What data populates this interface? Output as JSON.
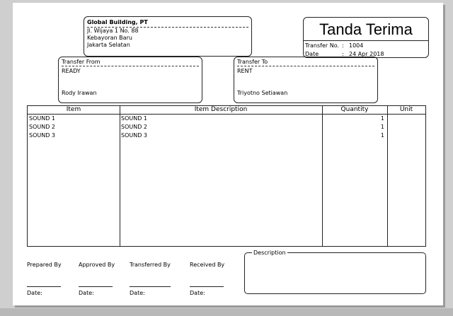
{
  "company": {
    "name": "Global Building, PT",
    "address": [
      "Jl. Wijaya 1 No. 88",
      "Kebayoran Baru",
      "Jakarta Selatan"
    ]
  },
  "doc": {
    "title": "Tanda Terima",
    "transfer_no_label": "Transfer No.",
    "transfer_no": "1004",
    "date_label": "Date",
    "date": "24 Apr 2018",
    "colon": ":"
  },
  "transfer_from": {
    "label": "Transfer From",
    "value": "READY",
    "person": "Rody Irawan"
  },
  "transfer_to": {
    "label": "Transfer To",
    "value": "RENT",
    "person": "Triyotno Setiawan"
  },
  "table": {
    "headers": {
      "item": "Item",
      "description": "Item Description",
      "quantity": "Quantity",
      "unit": "Unit"
    },
    "rows": [
      {
        "item": "SOUND 1",
        "description": "SOUND 1",
        "quantity": "1",
        "unit": ""
      },
      {
        "item": "SOUND 2",
        "description": "SOUND 2",
        "quantity": "1",
        "unit": ""
      },
      {
        "item": "SOUND 3",
        "description": "SOUND 3",
        "quantity": "1",
        "unit": ""
      }
    ]
  },
  "signatures": {
    "prepared": "Prepared By",
    "approved": "Approved By",
    "transferred": "Transferred By",
    "received": "Received By",
    "date_label": "Date:"
  },
  "description": {
    "label": "Description"
  }
}
